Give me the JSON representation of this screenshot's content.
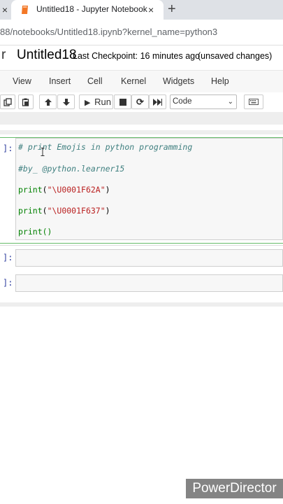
{
  "browser": {
    "tab_close_left": "×",
    "tab_title": "Untitled18 - Jupyter Notebook",
    "tab_close": "×",
    "new_tab": "+",
    "url": "88/notebooks/Untitled18.ipynb?kernel_name=python3"
  },
  "header": {
    "logo_fragment": "r",
    "notebook_title": "Untitled18",
    "checkpoint": "Last Checkpoint: 16 minutes ago",
    "save_status": "(unsaved changes)"
  },
  "menu": [
    "View",
    "Insert",
    "Cell",
    "Kernel",
    "Widgets",
    "Help"
  ],
  "toolbar": {
    "run_label": "Run",
    "cell_type": "Code",
    "icons": [
      "copy-icon",
      "paste-icon",
      "move-up-icon",
      "move-down-icon",
      "run-icon",
      "stop-icon",
      "restart-icon",
      "fast-forward-icon",
      "keyboard-icon"
    ]
  },
  "cells": [
    {
      "prompt": "]:",
      "lines": {
        "comment1": "# print Emojis in python programming",
        "comment2": "#by_ @python.learner15",
        "print1_fn": "print",
        "print1_arg": "\"\\U0001F62A\"",
        "print2_fn": "print",
        "print2_arg": "\"\\U0001F637\"",
        "print3_fn": "print",
        "print3_arg": "()"
      }
    },
    {
      "prompt": "]:"
    },
    {
      "prompt": "]:"
    }
  ],
  "watermark": "PowerDirector",
  "colors": {
    "prompt": "#303f9f",
    "comment": "#408080",
    "builtin": "#008000",
    "string": "#ba2121",
    "selected_border": "#66bb6a"
  }
}
